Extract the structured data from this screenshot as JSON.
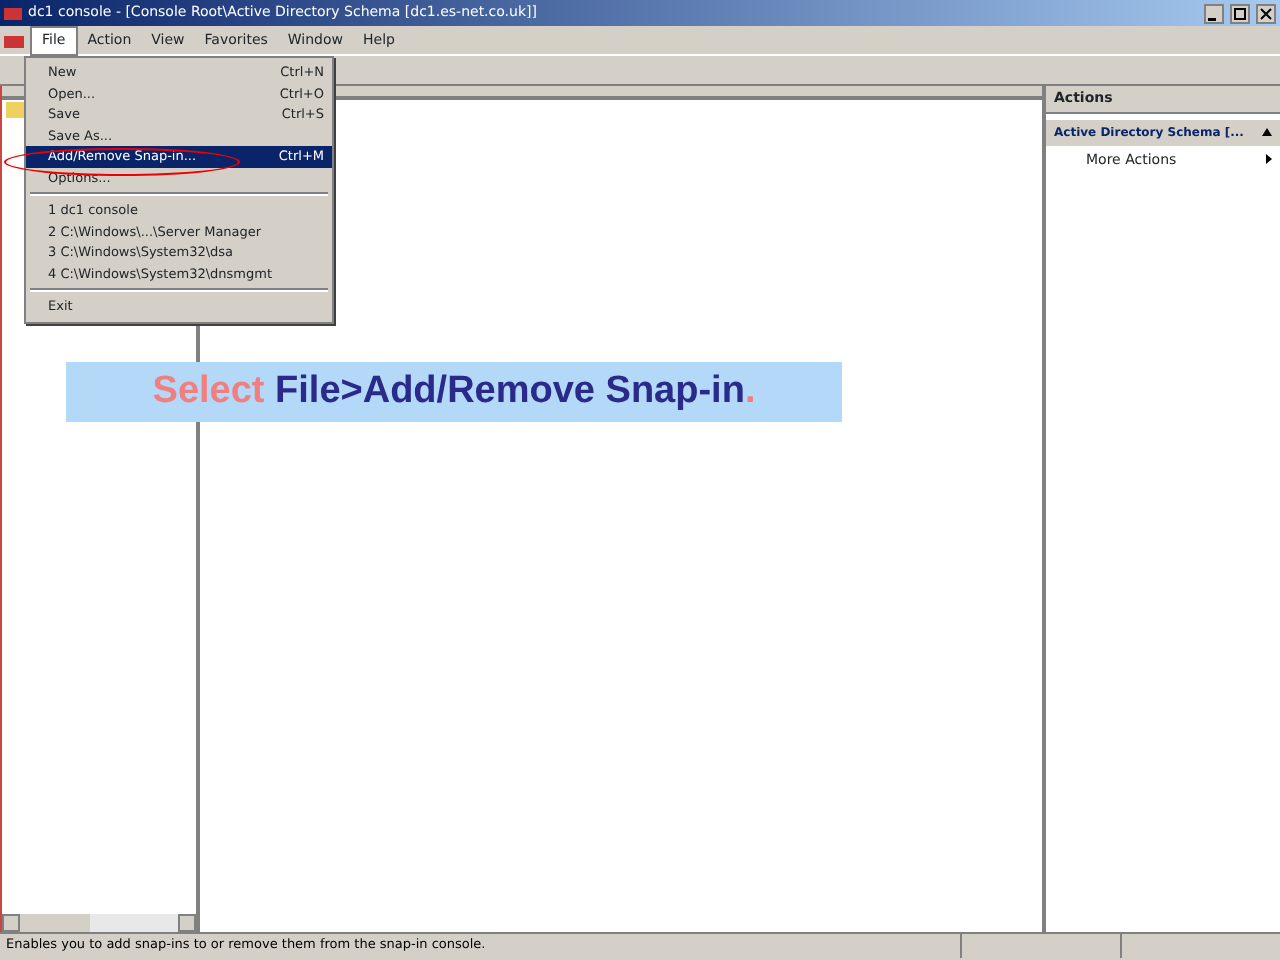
{
  "window": {
    "title": "dc1 console - [Console Root\\Active Directory Schema [dc1.es-net.co.uk]]"
  },
  "menu_bar": [
    {
      "label": "File",
      "selected": true
    },
    {
      "label": "Action",
      "selected": false
    },
    {
      "label": "View",
      "selected": false
    },
    {
      "label": "Favorites",
      "selected": false
    },
    {
      "label": "Window",
      "selected": false
    },
    {
      "label": "Help",
      "selected": false
    }
  ],
  "file_menu": [
    {
      "kind": "item",
      "label": "New",
      "shortcut": "Ctrl+N",
      "selected": false
    },
    {
      "kind": "item",
      "label": "Open...",
      "shortcut": "Ctrl+O",
      "selected": false
    },
    {
      "kind": "item",
      "label": "Save",
      "shortcut": "Ctrl+S",
      "selected": false
    },
    {
      "kind": "item",
      "label": "Save As...",
      "selected": false
    },
    {
      "kind": "item",
      "label": "Add/Remove Snap-in...",
      "shortcut": "Ctrl+M",
      "selected": true
    },
    {
      "kind": "item",
      "label": "Options...",
      "selected": false
    },
    {
      "kind": "separator"
    },
    {
      "kind": "item",
      "label": "1 dc1 console",
      "selected": false
    },
    {
      "kind": "item",
      "label": "2 C:\\Windows\\...\\Server Manager",
      "selected": false
    },
    {
      "kind": "item",
      "label": "3 C:\\Windows\\System32\\dsa",
      "selected": false
    },
    {
      "kind": "item",
      "label": "4 C:\\Windows\\System32\\dnsmgmt",
      "selected": false
    },
    {
      "kind": "separator"
    },
    {
      "kind": "item",
      "label": "Exit",
      "selected": false
    }
  ],
  "actions_pane": {
    "title": "Actions",
    "section": "Active Directory Schema [...",
    "items": [
      "More Actions"
    ]
  },
  "callout": [
    {
      "kind": "accent",
      "text": "Select "
    },
    {
      "kind": "plain",
      "text": "File>Add/Remove Snap-in"
    },
    {
      "kind": "accent",
      "text": "."
    }
  ],
  "status_bar": {
    "text": "Enables you to add snap-ins to or remove them from the snap-in console."
  }
}
